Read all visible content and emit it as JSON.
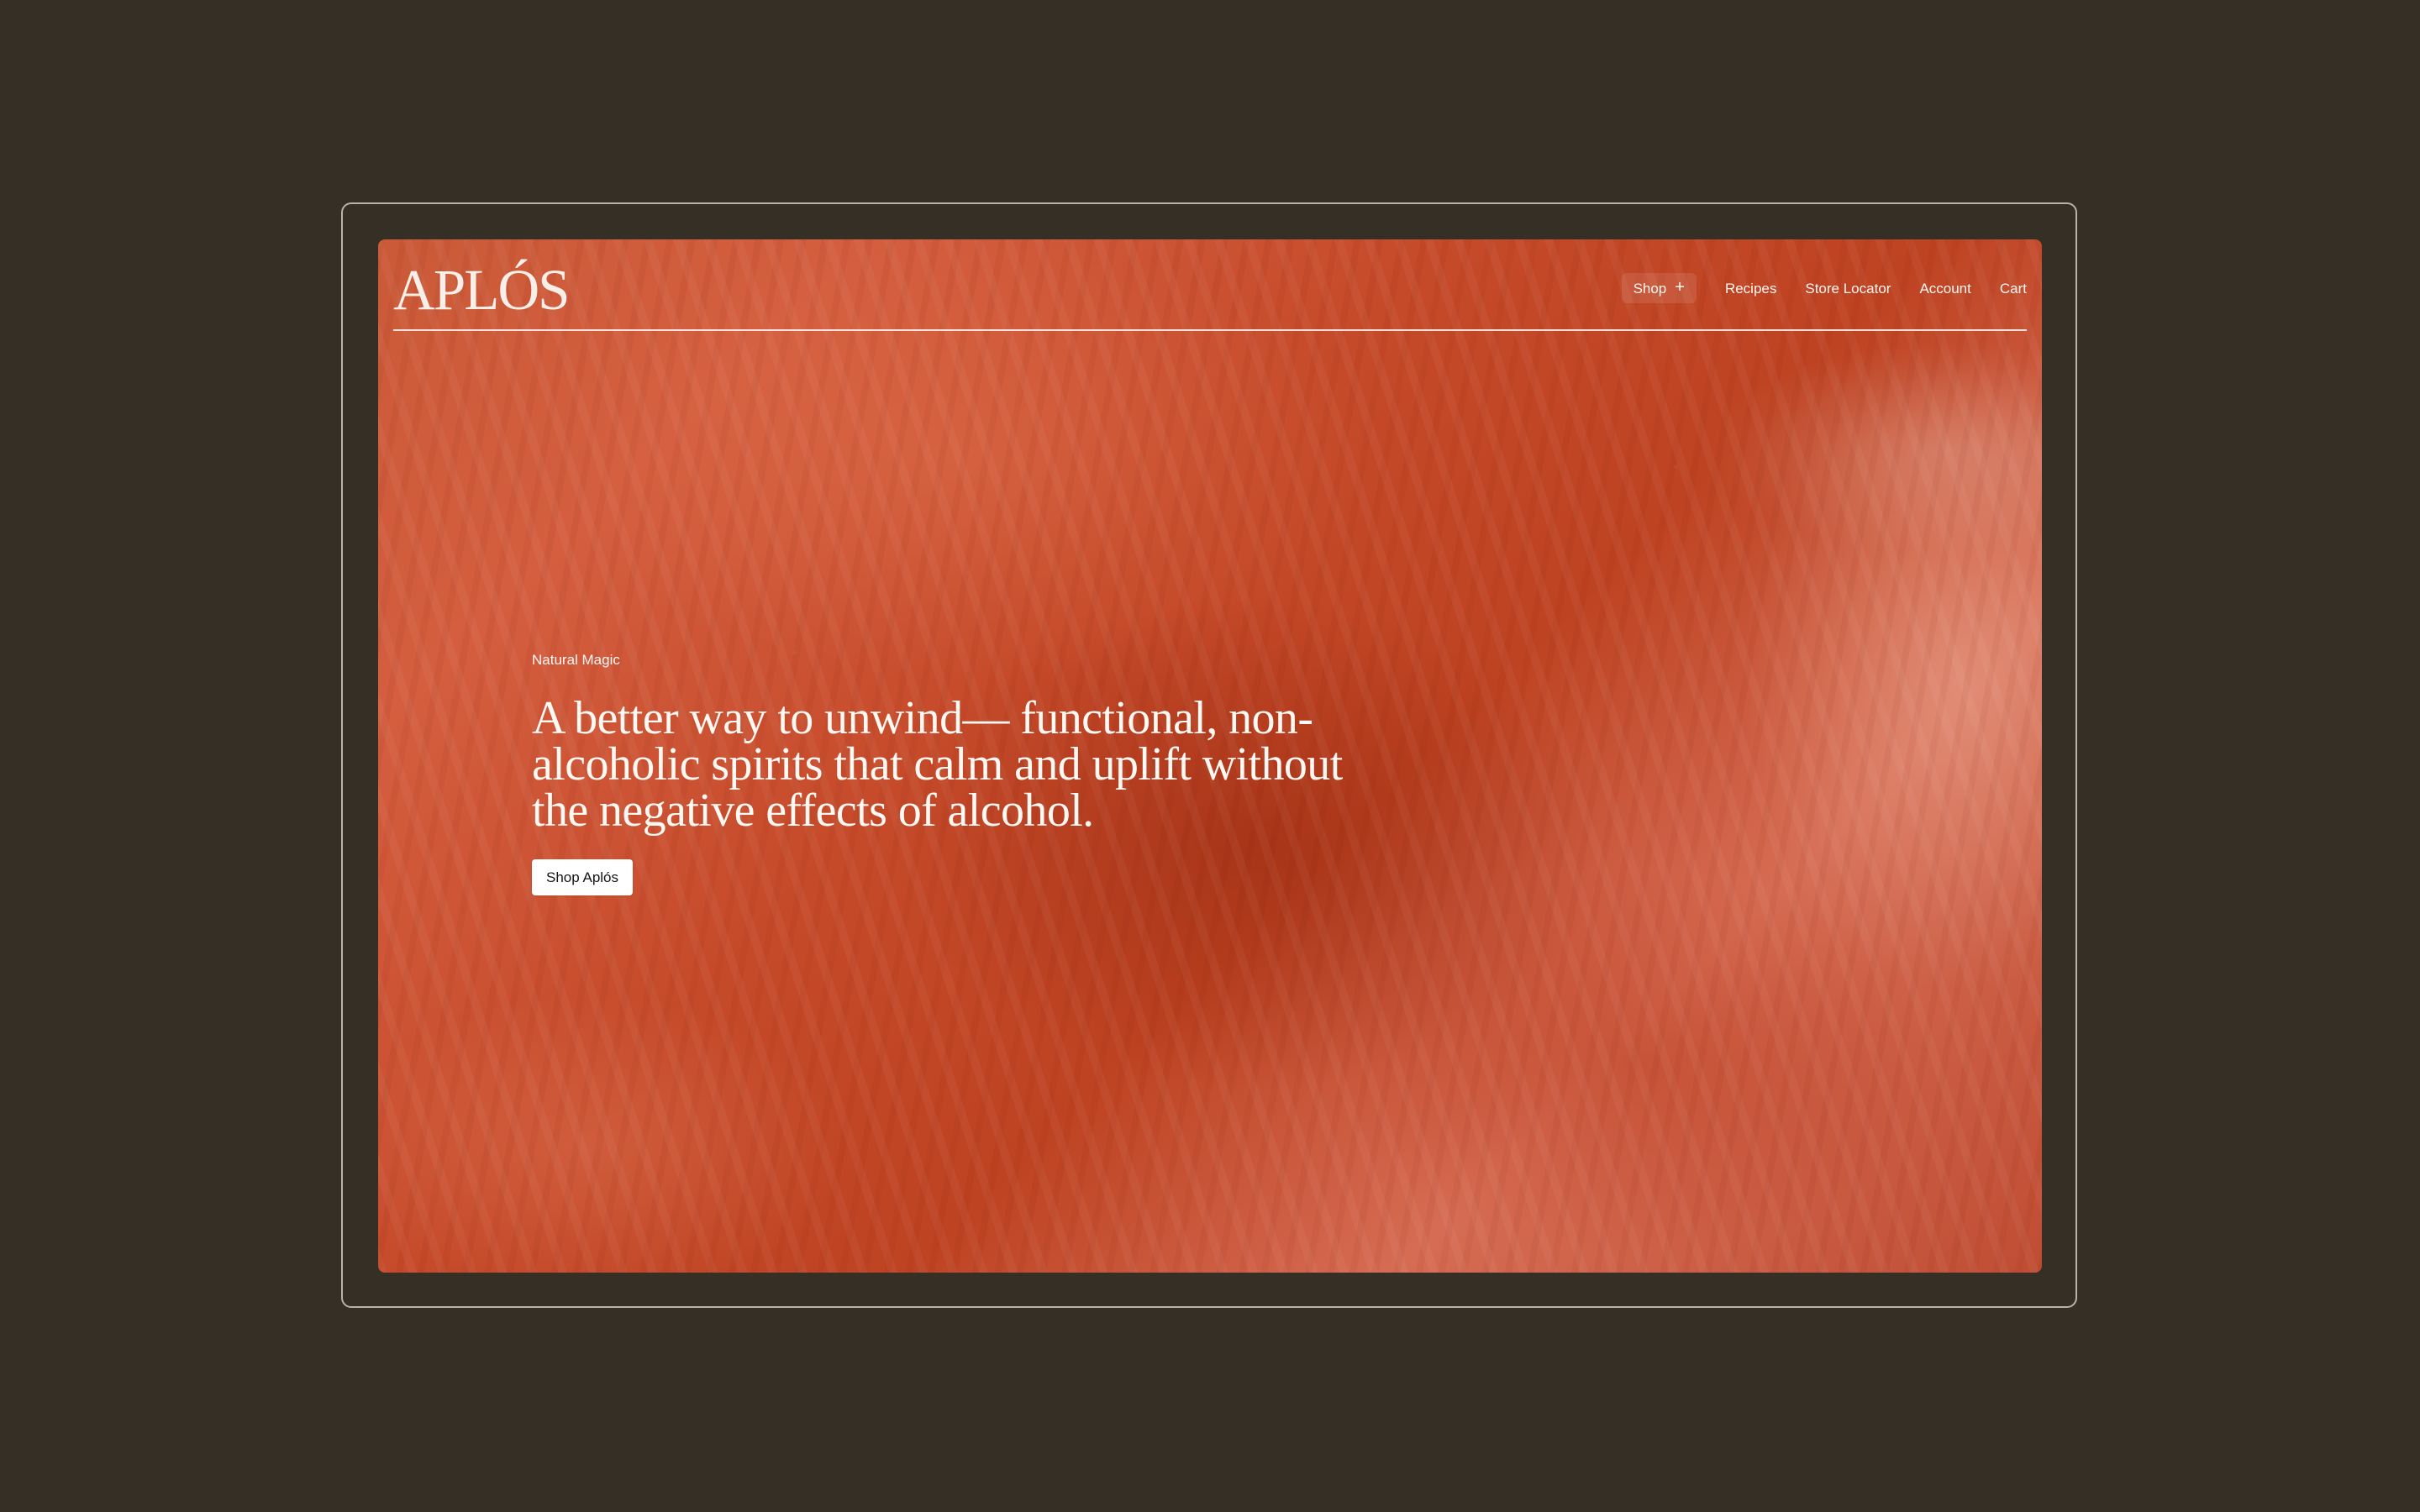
{
  "brand": {
    "logo_text": "APLÓS"
  },
  "nav": {
    "items": [
      {
        "label": "Shop",
        "icon": "plus-icon"
      },
      {
        "label": "Recipes"
      },
      {
        "label": "Store Locator"
      },
      {
        "label": "Account"
      },
      {
        "label": "Cart"
      }
    ]
  },
  "hero": {
    "eyebrow": "Natural Magic",
    "headline": "A better way to unwind— functional, non-alcoholic spirits that calm and uplift without the negative effects of alcohol.",
    "cta_label": "Shop Aplós"
  },
  "colors": {
    "page_background": "#362f26",
    "frame_border": "#b9b2a6",
    "hero_base": "#c54a2a",
    "text_light": "#fff8f3",
    "button_background": "#ffffff",
    "button_text": "#141414"
  }
}
